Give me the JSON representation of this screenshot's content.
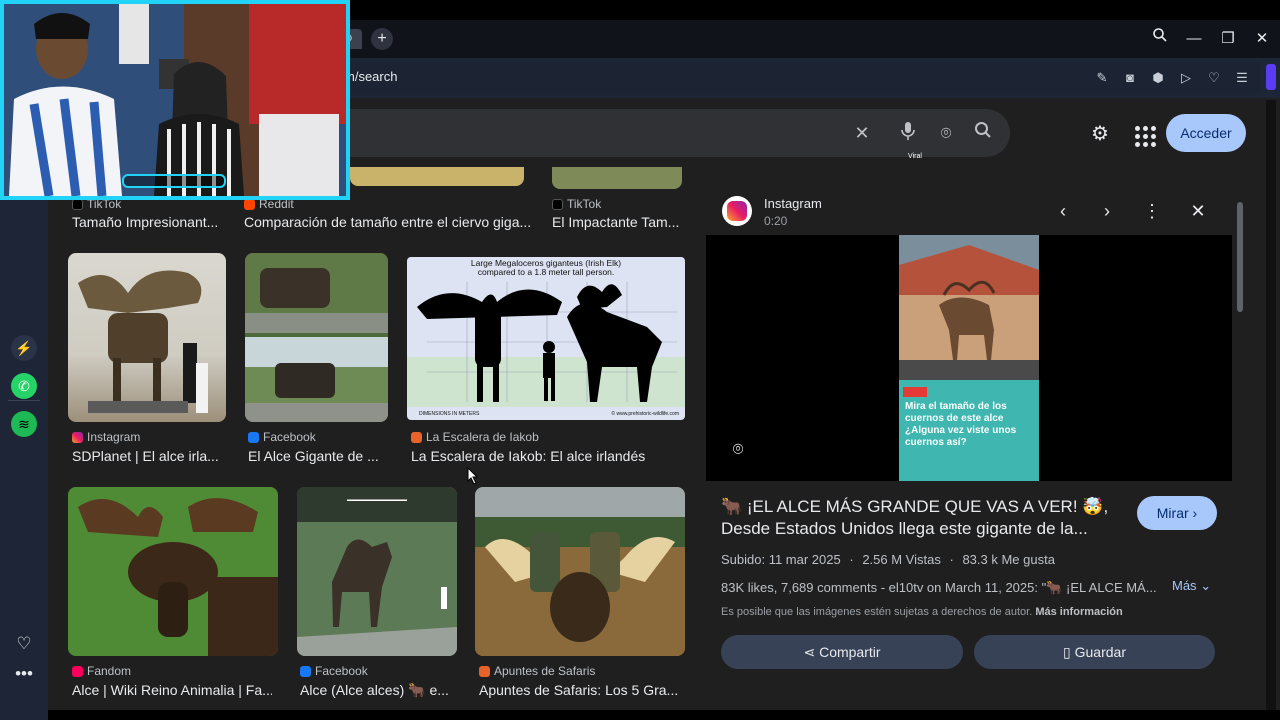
{
  "browser": {
    "tab_label": "o",
    "new_tab": "+",
    "url": "m/search",
    "window_buttons": [
      "search-icon",
      "minimize-icon",
      "restore-icon",
      "close-icon"
    ]
  },
  "google": {
    "acceder": "Acceder"
  },
  "results_top": [
    {
      "source": "TikTok",
      "title": "Tamaño Impresionant..."
    },
    {
      "source": "Reddit",
      "title": "Comparación de tamaño entre el ciervo giga..."
    },
    {
      "source": "TikTok",
      "title": "El Impactante Tam..."
    }
  ],
  "results_row1": [
    {
      "source": "Instagram",
      "title": "SDPlanet | El alce irla..."
    },
    {
      "source": "Facebook",
      "title": "El Alce Gigante de ..."
    },
    {
      "source": "La Escalera de Iakob",
      "title": "La Escalera de Iakob: El alce irlandés"
    }
  ],
  "results_row2": [
    {
      "source": "Fandom",
      "title": "Alce | Wiki Reino Animalia | Fa..."
    },
    {
      "source": "Facebook",
      "title": "Alce (Alce alces) 🐂 e..."
    },
    {
      "source": "Apuntes de Safaris",
      "title": "Apuntes de Safaris: Los 5 Gra..."
    }
  ],
  "chart_image": {
    "title_line1": "Large Megaloceros giganteus (Irish Elk)",
    "title_line2": "compared to a 1.8 meter tall person.",
    "footer_left": "DIMENSIONS IN METERS",
    "footer_right": "© www.prehistoric-wildlife.com"
  },
  "panel": {
    "source": "Instagram",
    "duration": "0:20",
    "title_line1": "🐂 ¡EL ALCE MÁS GRANDE QUE VAS A VER! 🤯,",
    "title_line2": "Desde Estados Unidos llega este gigante de la...",
    "mirar": "Mirar",
    "uploaded": "Subido: 11 mar 2025",
    "views": "2.56 M Vistas",
    "likes": "83.3 k Me gusta",
    "description": "83K likes, 7,689 comments - el10tv on March 11, 2025: \"🐂 ¡EL ALCE MÁ...",
    "mas": "Más",
    "copyright": "Es posible que las imágenes estén sujetas a derechos de autor.",
    "more_info": "Más información",
    "share": "Compartir",
    "save": "Guardar",
    "video_caption_tag": "Viral",
    "video_caption": "Mira el tamaño de los cuernos de este alce ¿Alguna vez viste unos cuernos así?"
  },
  "colors": {
    "accent": "#a8c7fa",
    "webcam_border": "#21d4f7"
  }
}
